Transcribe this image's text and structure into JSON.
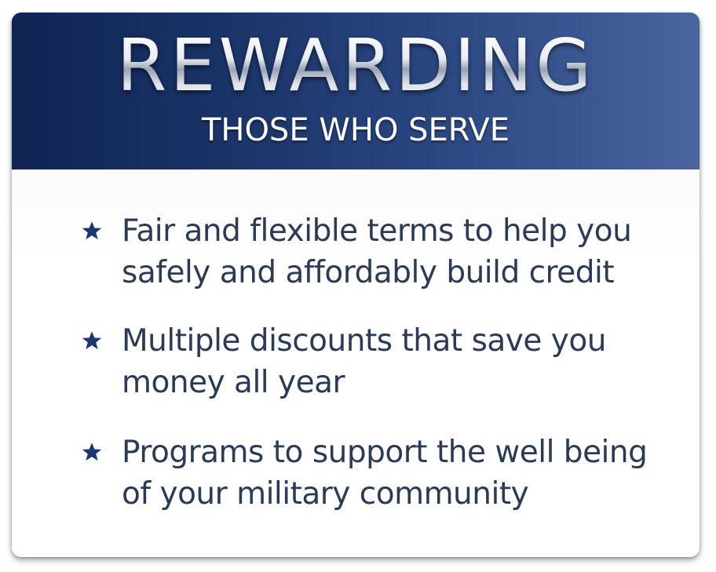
{
  "header": {
    "title": "REWARDING",
    "subtitle": "THOSE WHO SERVE"
  },
  "benefits": [
    {
      "text": "Fair and flexible terms to help you safely and affordably build credit",
      "icon": "star-icon"
    },
    {
      "text": "Multiple discounts that save you money all year",
      "icon": "star-icon"
    },
    {
      "text": "Programs to support the well being of your military community",
      "icon": "star-icon"
    }
  ],
  "colors": {
    "header_dark": "#0f2453",
    "header_light": "#4a65a0",
    "star": "#1d3570",
    "body_text": "#2b3a55"
  }
}
